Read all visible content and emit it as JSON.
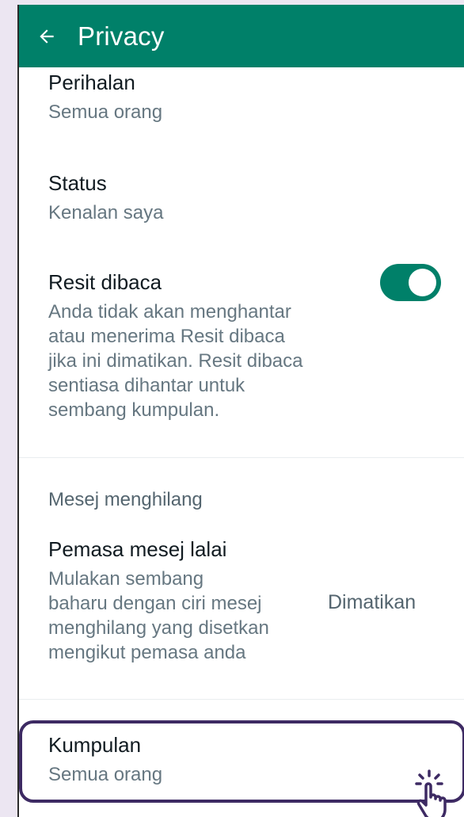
{
  "header": {
    "title": "Privacy",
    "back_icon": "arrow-left-icon",
    "background": "#008069"
  },
  "items": {
    "perihalan": {
      "label": "Perihalan",
      "value": "Semua orang"
    },
    "status": {
      "label": "Status",
      "value": "Kenalan saya"
    },
    "read_receipts": {
      "label": "Resit dibaca",
      "lines": [
        "Anda tidak akan menghantar",
        "atau menerima Resit dibaca",
        "jika ini dimatikan. Resit dibaca",
        "sentiasa dihantar untuk",
        "sembang kumpulan."
      ],
      "toggle_on": true
    },
    "disappearing_section": {
      "header": "Mesej menghilang"
    },
    "default_timer": {
      "label": "Pemasa mesej lalai",
      "lines": [
        "Mulakan sembang",
        "baharu dengan ciri mesej",
        "menghilang yang disetkan",
        "mengikut pemasa anda"
      ],
      "value": "Dimatikan"
    },
    "groups": {
      "label": "Kumpulan",
      "value": "Semua orang"
    }
  },
  "cursor_icon": "hand-pointer-click-icon",
  "accent_color": "#008069",
  "highlight_color": "#3d2a63"
}
